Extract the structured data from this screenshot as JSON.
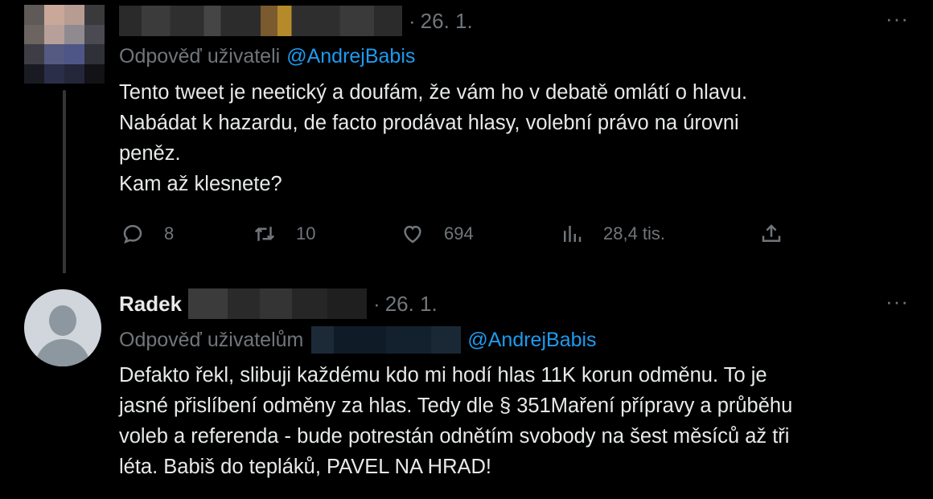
{
  "tweet1": {
    "date": "26. 1.",
    "more": "···",
    "reply_prefix": "Odpověď uživateli",
    "reply_mention": "@AndrejBabis",
    "lines": [
      "Tento tweet je neetický a doufám, že vám ho v debatě omlátí o hlavu.",
      "Nabádat k hazardu, de facto prodávat hlasy, volební právo na úrovni",
      "peněz.",
      "Kam až klesnete?"
    ],
    "actions": {
      "replies": "8",
      "retweets": "10",
      "likes": "694",
      "views": "28,4 tis."
    },
    "icons": [
      "reply-icon",
      "retweet-icon",
      "like-icon",
      "views-icon",
      "share-icon"
    ]
  },
  "tweet2": {
    "name": "Radek",
    "date": "26. 1.",
    "more": "···",
    "reply_prefix": "Odpověď uživatelům",
    "reply_mention": "@AndrejBabis",
    "lines": [
      "Defakto řekl, slibuji každému kdo mi hodí hlas 11K korun odměnu. To je",
      "jasné přislíbení odměny za hlas. Tedy dle § 351Maření přípravy a průběhu",
      "voleb a referenda - bude potrestán odnětím svobody na šest měsíců až tři",
      "léta. Babiš do tepláků, PAVEL NA HRAD!"
    ]
  },
  "colors": {
    "background": "#000000",
    "text": "#e7e9ea",
    "muted": "#71767b",
    "link": "#1d9bf0"
  }
}
